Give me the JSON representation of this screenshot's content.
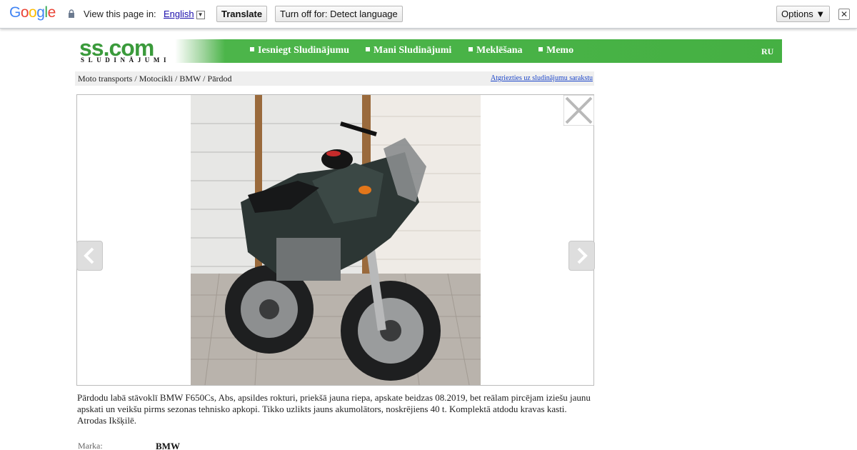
{
  "translate_bar": {
    "logo_letters": [
      {
        "ch": "G",
        "color": "#4285f4"
      },
      {
        "ch": "o",
        "color": "#ea4335"
      },
      {
        "ch": "o",
        "color": "#fbbc05"
      },
      {
        "ch": "g",
        "color": "#4285f4"
      },
      {
        "ch": "l",
        "color": "#34a853"
      },
      {
        "ch": "e",
        "color": "#ea4335"
      }
    ],
    "view_text": "View this page in:",
    "language": "English",
    "language_arrow": "▼",
    "translate_button": "Translate",
    "turn_off_button": "Turn off for: Detect language",
    "options_button": "Options ▼",
    "close_glyph": "✕"
  },
  "site": {
    "logo": "ss.com",
    "logo_sub": "SLUDINĀJUMI",
    "nav": [
      "Iesniegt Sludinājumu",
      "Mani Sludinājumi",
      "Meklēšana",
      "Memo"
    ],
    "lang": "RU",
    "accent": "#45b043"
  },
  "breadcrumb": {
    "items": [
      "Moto transports",
      "Motocikli",
      "BMW",
      "Pārdod"
    ],
    "separator": " / ",
    "back_link": "Atgriezties uz sludinājumu sarakstu"
  },
  "listing": {
    "description": "Pārdodu labā stāvoklī BMW F650Cs, Abs, apsildes rokturi, priekšā jauna riepa, apskate beidzas 08.2019, bet reālam pircējam iziešu jaunu apskati un veikšu pirms sezonas tehnisko apkopi. Tikko uzlikts jauns akumolātors, noskrējiens 40 t. Komplektā atdodu kravas kasti. Atrodas Ikšķilē.",
    "specs": [
      {
        "label": "Marka:",
        "value": "BMW"
      }
    ]
  }
}
